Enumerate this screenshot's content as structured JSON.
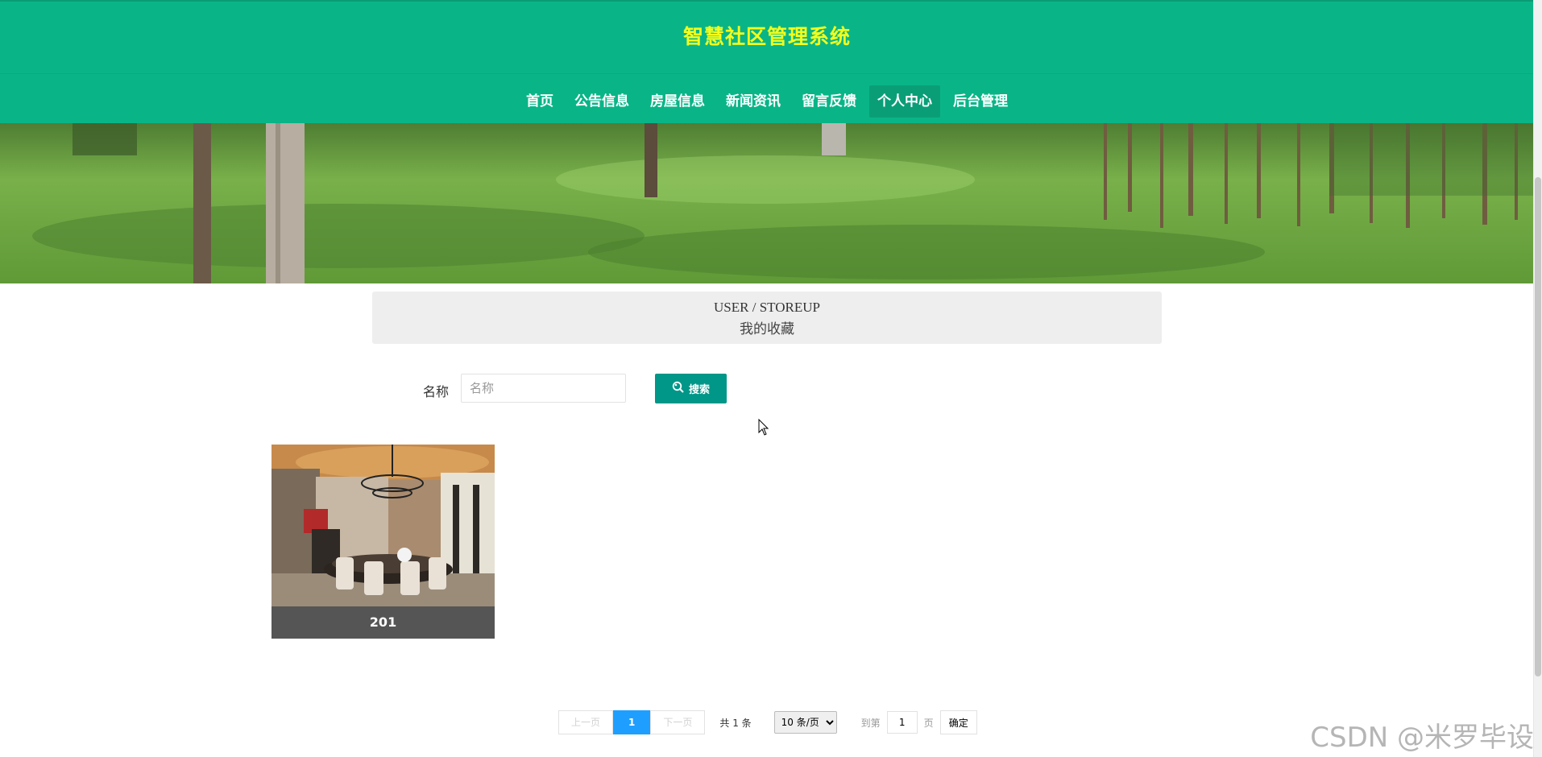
{
  "header": {
    "title": "智慧社区管理系统",
    "nav": [
      {
        "label": "首页",
        "active": false
      },
      {
        "label": "公告信息",
        "active": false
      },
      {
        "label": "房屋信息",
        "active": false
      },
      {
        "label": "新闻资讯",
        "active": false
      },
      {
        "label": "留言反馈",
        "active": false
      },
      {
        "label": "个人中心",
        "active": true
      },
      {
        "label": "后台管理",
        "active": false
      }
    ]
  },
  "section": {
    "en_title": "USER / STOREUP",
    "zh_title": "我的收藏"
  },
  "search": {
    "label": "名称",
    "placeholder": "名称",
    "value": "",
    "button_label": "搜索",
    "button_icon": "search-icon"
  },
  "items": [
    {
      "title": "201",
      "image": "dining-room-photo"
    }
  ],
  "pagination": {
    "prev_label": "上一页",
    "current_page": "1",
    "next_label": "下一页",
    "total_text": "共 1 条",
    "page_size": "10 条/页",
    "page_size_options": [
      "10 条/页"
    ],
    "goto_label": "到第",
    "goto_value": "1",
    "page_unit": "页",
    "confirm_label": "确定"
  },
  "watermark": "CSDN @米罗毕设",
  "colors": {
    "header_bg": "#09b587",
    "title_color": "#f4ff1c",
    "nav_active_bg": "#0a9e77",
    "search_button_bg": "#009688",
    "pager_current_bg": "#1e9fff",
    "card_title_bg": "#555555"
  }
}
